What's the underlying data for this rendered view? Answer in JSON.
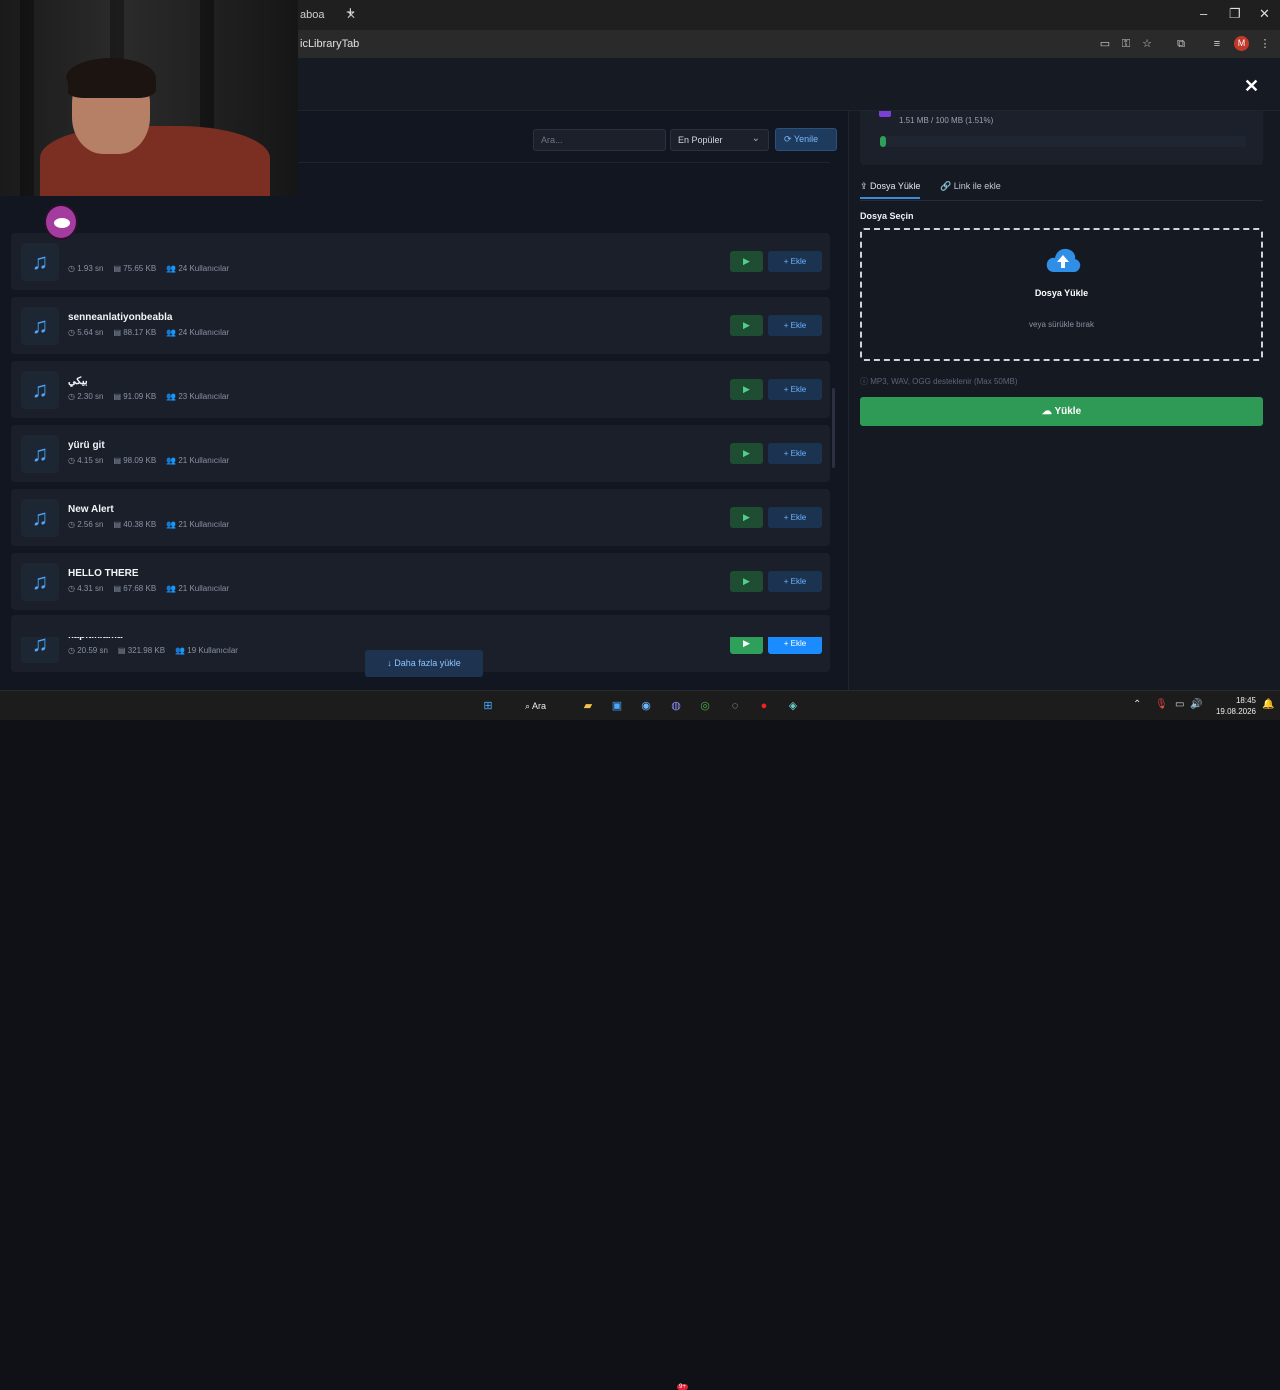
{
  "browser": {
    "tab_title": "aboa",
    "tab_close": "✕",
    "new_tab": "+",
    "url": "icLibraryTab",
    "profile_initial": "M",
    "controls": {
      "minimize": "–",
      "maximize": "❐",
      "close": "✕"
    }
  },
  "modal": {
    "close_label": "✕"
  },
  "library": {
    "search_placeholder": "Ara...",
    "sort_value": "En Popüler",
    "refresh_label": "Yenile",
    "add_label": "Ekle",
    "load_more_label": "Daha fazla yükle",
    "items": [
      {
        "title": "",
        "duration": "1.93 sn",
        "size": "75.65 KB",
        "users": "24 Kullanıcılar"
      },
      {
        "title": "senneanlatiyonbeabla",
        "duration": "5.64 sn",
        "size": "88.17 KB",
        "users": "24 Kullanıcılar"
      },
      {
        "title": "بيكي",
        "duration": "2.30 sn",
        "size": "91.09 KB",
        "users": "23 Kullanıcılar"
      },
      {
        "title": "yürü git",
        "duration": "4.15 sn",
        "size": "98.09 KB",
        "users": "21 Kullanıcılar"
      },
      {
        "title": "New Alert",
        "duration": "2.56 sn",
        "size": "40.38 KB",
        "users": "21 Kullanıcılar"
      },
      {
        "title": "HELLO THERE",
        "duration": "4.31 sn",
        "size": "67.68 KB",
        "users": "21 Kullanıcılar"
      },
      {
        "title": "kapıtıklama",
        "duration": "20.59 sn",
        "size": "321.98 KB",
        "users": "19 Kullanıcılar"
      }
    ]
  },
  "upload": {
    "storage_text": "1.51 MB / 100 MB (1.51%)",
    "storage_fraction": 0.0151,
    "tab_upload": "Dosya Yükle",
    "tab_link": "Link ile ekle",
    "file_label": "Dosya Seçin",
    "drop_title": "Dosya Yükle",
    "drop_sub": "veya sürükle bırak",
    "support_text": "MP3, WAV, OGG desteklenir (Max 50MB)",
    "upload_button": "Yükle"
  },
  "taskbar": {
    "search_label": "Ara",
    "time": "18:45",
    "date": "19.08.2026",
    "discord_badge": "9+"
  },
  "colors": {
    "accent": "#1a8cff",
    "success": "#2e9a55",
    "bg": "#12151c"
  }
}
